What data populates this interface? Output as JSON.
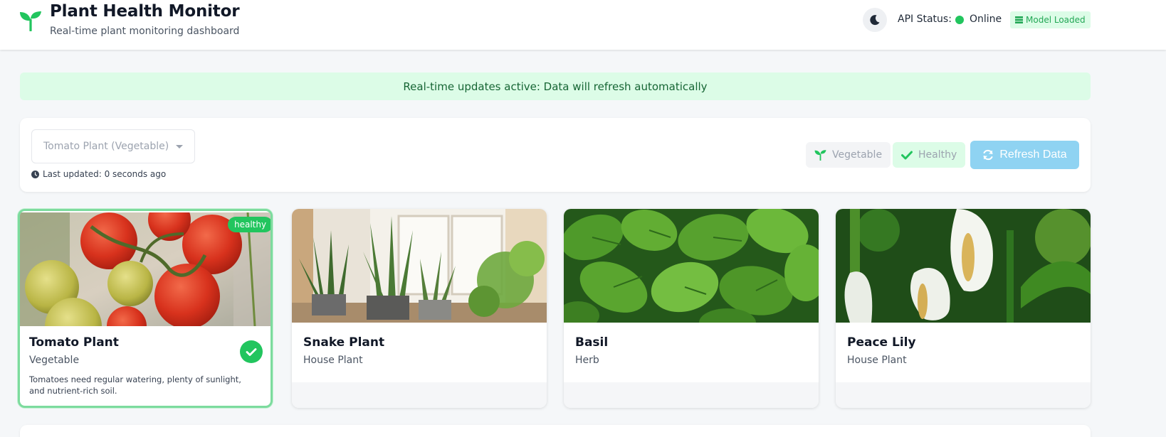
{
  "header": {
    "title": "Plant Health Monitor",
    "subtitle": "Real-time plant monitoring dashboard",
    "logo_icon": "sprout-icon",
    "theme_icon": "moon-icon",
    "api_status_label": "API Status:",
    "api_status_value": "Online",
    "model_badge": "Model Loaded"
  },
  "banner": {
    "text": "Real-time updates active: Data will refresh automatically"
  },
  "toolbar": {
    "selected_plant": "Tomato Plant (Vegetable)",
    "last_updated": "Last updated: 0 seconds ago",
    "category_chip": "Vegetable",
    "health_chip": "Healthy",
    "refresh_label": "Refresh Data"
  },
  "cards": [
    {
      "name": "Tomato Plant",
      "category": "Vegetable",
      "description": "Tomatoes need regular watering, plenty of sunlight, and nutrient-rich soil.",
      "status_badge": "healthy",
      "selected": true
    },
    {
      "name": "Snake Plant",
      "category": "House Plant"
    },
    {
      "name": "Basil",
      "category": "Herb"
    },
    {
      "name": "Peace Lily",
      "category": "House Plant"
    }
  ],
  "colors": {
    "accent_green": "#22c55e",
    "banner_bg": "#dcfce7",
    "refresh_button": "#8fd3f2"
  }
}
